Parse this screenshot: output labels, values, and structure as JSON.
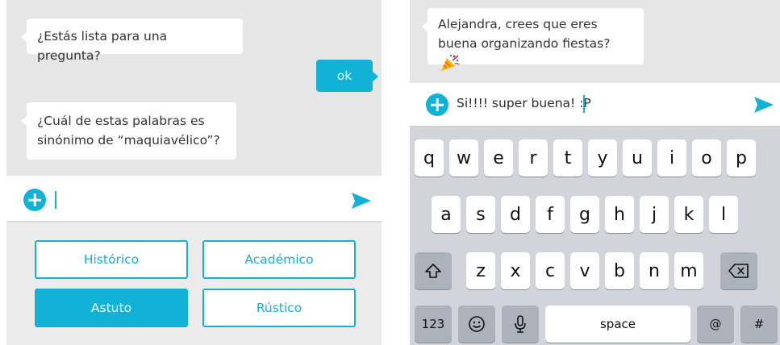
{
  "left": {
    "messages": {
      "question_intro": "¿Estás lista para una pregunta?",
      "reply": "ok",
      "question_line1": "¿Cuál de estas palabras es",
      "question_line2": "sinónimo de “maquiavélico”?"
    },
    "input": {
      "value": ""
    },
    "options": [
      {
        "label": "Histórico",
        "selected": false
      },
      {
        "label": "Académico",
        "selected": false
      },
      {
        "label": "Astuto",
        "selected": true
      },
      {
        "label": "Rústico",
        "selected": false
      }
    ]
  },
  "right": {
    "message_line1": "Alejandra, crees que eres",
    "message_line2": "buena organizando fiestas?",
    "message_emoji": "party-popper-icon",
    "input": {
      "value": "Si!!!! super buena! :P"
    },
    "keyboard": {
      "row1": [
        "q",
        "w",
        "e",
        "r",
        "t",
        "y",
        "u",
        "i",
        "o",
        "p"
      ],
      "row2": [
        "a",
        "s",
        "d",
        "f",
        "g",
        "h",
        "j",
        "k",
        "l"
      ],
      "row3": [
        "z",
        "x",
        "c",
        "v",
        "b",
        "n",
        "m"
      ],
      "numbers_key": "123",
      "space_key": "space",
      "at_key": "@",
      "hash_key": "#"
    }
  },
  "colors": {
    "accent": "#12b2d6",
    "chat_bg": "#e6e6e6",
    "keyboard_bg": "#d1d4da"
  }
}
